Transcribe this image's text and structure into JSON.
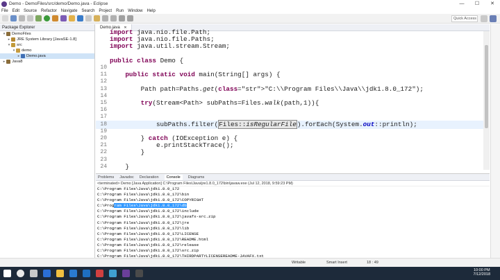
{
  "window": {
    "title": "Demo - DemoFiles/src/demo/Demo.java - Eclipse",
    "minimize": "—",
    "maximize": "☐",
    "close": "✕"
  },
  "menu": [
    "File",
    "Edit",
    "Source",
    "Refactor",
    "Navigate",
    "Search",
    "Project",
    "Run",
    "Window",
    "Help"
  ],
  "toolbar": {
    "quick_access_placeholder": "Quick Access"
  },
  "package_explorer": {
    "tab_label": "Package Explorer",
    "items": [
      {
        "label": "DemoFiles",
        "indent": 0,
        "arrow": "▾",
        "icon_color": "#8a6d3b"
      },
      {
        "label": "JRE System Library [JavaSE-1.8]",
        "indent": 1,
        "arrow": "▸",
        "icon_color": "#b58a36"
      },
      {
        "label": "src",
        "indent": 1,
        "arrow": "▾",
        "icon_color": "#c19a3a"
      },
      {
        "label": "demo",
        "indent": 2,
        "arrow": "▾",
        "icon_color": "#c59b3f"
      },
      {
        "label": "Demo.java",
        "indent": 3,
        "arrow": "▸",
        "icon_color": "#3f6fb5"
      },
      {
        "label": "Java8",
        "indent": 0,
        "arrow": "▸",
        "icon_color": "#8a6d3b"
      }
    ]
  },
  "editor": {
    "tab_label": "Demo.java",
    "close_glyph": "✕",
    "lines": [
      {
        "num": "",
        "text": "import java.nio.file.Path;"
      },
      {
        "num": "",
        "text": "import java.nio.file.Paths;"
      },
      {
        "num": "",
        "text": "import java.util.stream.Stream;"
      },
      {
        "num": "",
        "text": ""
      },
      {
        "num": "",
        "text": "public class Demo {"
      },
      {
        "num": "10",
        "text": ""
      },
      {
        "num": "11",
        "text": "    public static void main(String[] args) {"
      },
      {
        "num": "12",
        "text": ""
      },
      {
        "num": "13",
        "text": "        Path path=Paths.get(\"C:\\\\Program Files\\\\Java\\\\jdk1.8.0_172\");"
      },
      {
        "num": "14",
        "text": ""
      },
      {
        "num": "15",
        "text": "        try(Stream<Path> subPaths=Files.walk(path,1)){"
      },
      {
        "num": "16",
        "text": ""
      },
      {
        "num": "17",
        "text": ""
      },
      {
        "num": "18",
        "text": "            subPaths.filter(Files::isRegularFile).forEach(System.out::println);"
      },
      {
        "num": "19",
        "text": ""
      },
      {
        "num": "20",
        "text": "        } catch (IOException e) {"
      },
      {
        "num": "21",
        "text": "            e.printStackTrace();"
      },
      {
        "num": "22",
        "text": "        }"
      },
      {
        "num": "23",
        "text": ""
      },
      {
        "num": "24",
        "text": "    }"
      }
    ]
  },
  "console": {
    "tabs": [
      "Problems",
      "Javadoc",
      "Declaration",
      "Console",
      "Diagrams"
    ],
    "active_tab": "Console",
    "terminated": "<terminated> Demo [Java Application] C:\\Program Files\\Java\\jre1.8.0_172\\bin\\javaw.exe (Jul 12, 2018, 9:59:23 PM)",
    "lines": [
      "C:\\Program Files\\Java\\jdk1.8.0_172",
      "C:\\Program Files\\Java\\jdk1.8.0_172\\bin",
      "C:\\Program Files\\Java\\jdk1.8.0_172\\COPYRIGHT",
      "C:\\Program Files\\Java\\jdk1.8.0_172\\db",
      "C:\\Program Files\\Java\\jdk1.8.0_172\\include",
      "C:\\Program Files\\Java\\jdk1.8.0_172\\javafx-src.zip",
      "C:\\Program Files\\Java\\jdk1.8.0_172\\jre",
      "C:\\Program Files\\Java\\jdk1.8.0_172\\lib",
      "C:\\Program Files\\Java\\jdk1.8.0_172\\LICENSE",
      "C:\\Program Files\\Java\\jdk1.8.0_172\\README.html",
      "C:\\Program Files\\Java\\jdk1.8.0_172\\release",
      "C:\\Program Files\\Java\\jdk1.8.0_172\\src.zip",
      "C:\\Program Files\\Java\\jdk1.8.0_172\\THIRDPARTYLICENSEREADME-JAVAFX.txt"
    ],
    "selected_line_index": 3,
    "selected_prefix": "C:\\Prog",
    "selected_text": "ram Files\\Java\\jdk1.8.0_172\\db"
  },
  "status": {
    "writable": "Writable",
    "insert_mode": "Smart Insert",
    "position": "18 : 49"
  },
  "taskbar": {
    "time": "10:00 PM",
    "date": "7/12/2018"
  },
  "colors": {
    "keyword": "#7f0055",
    "string": "#2a00ff",
    "selection": "#3399ff",
    "taskbar": "#1d2a3a"
  }
}
